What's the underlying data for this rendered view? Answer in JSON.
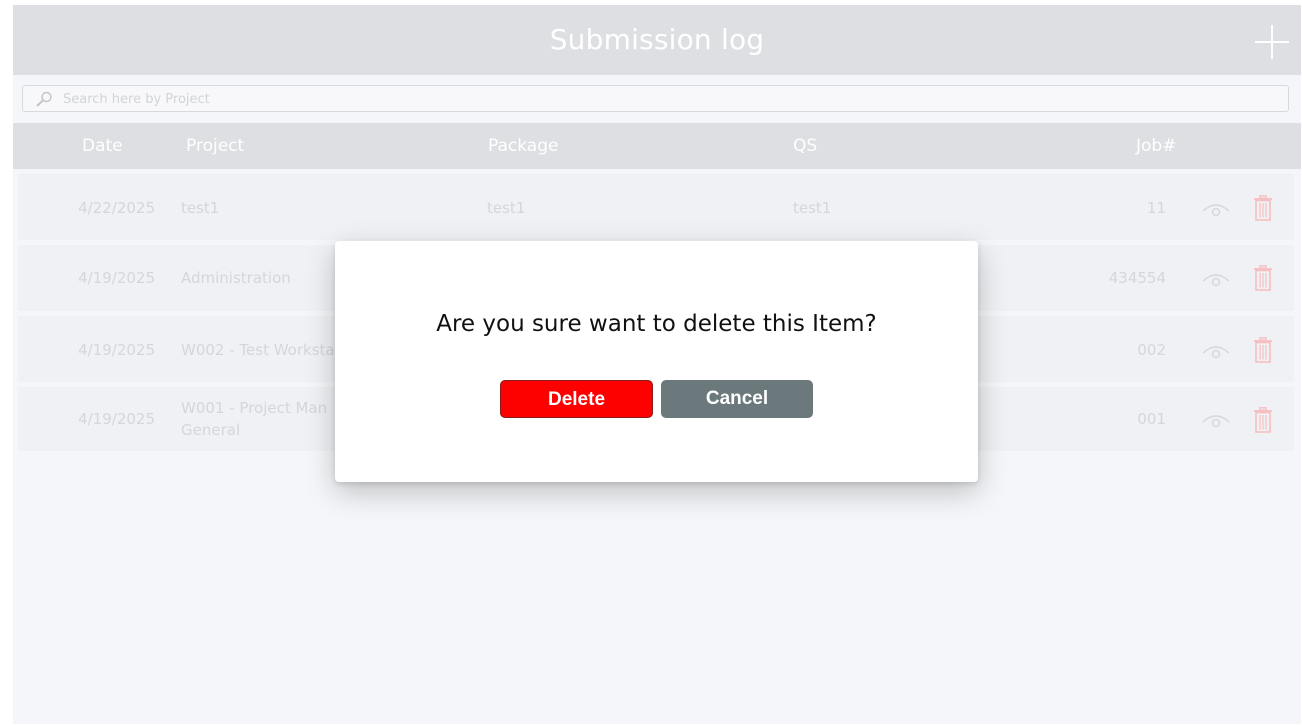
{
  "header": {
    "title": "Submission log",
    "add_icon": "plus-icon"
  },
  "search": {
    "placeholder": "Search here by Project",
    "value": ""
  },
  "table": {
    "columns": {
      "date": "Date",
      "project": "Project",
      "package": "Package",
      "qs": "QS",
      "job": "Job#"
    },
    "rows": [
      {
        "date": "4/22/2025",
        "project": "test1",
        "project_line2": "",
        "package": "test1",
        "qs": "test1",
        "job": "11"
      },
      {
        "date": "4/19/2025",
        "project": "Administration",
        "project_line2": "",
        "package": "",
        "qs": "",
        "job": "434554"
      },
      {
        "date": "4/19/2025",
        "project": "W002 - Test Worksta",
        "project_line2": "",
        "package": "",
        "qs": "",
        "job": "002"
      },
      {
        "date": "4/19/2025",
        "project": "W001 - Project Man",
        "project_line2": "General",
        "package": "",
        "qs": "",
        "job": "001"
      }
    ],
    "row_icons": {
      "view": "eye-icon",
      "delete": "trash-icon"
    }
  },
  "modal": {
    "message": "Are you sure want to delete this Item?",
    "delete_label": "Delete",
    "cancel_label": "Cancel"
  },
  "colors": {
    "header_bg": "#d0d3d7",
    "row_bg": "#e9ecf1",
    "delete_button": "#fd0000",
    "cancel_button": "#6b787c",
    "trash_icon": "#f4a5a8"
  }
}
